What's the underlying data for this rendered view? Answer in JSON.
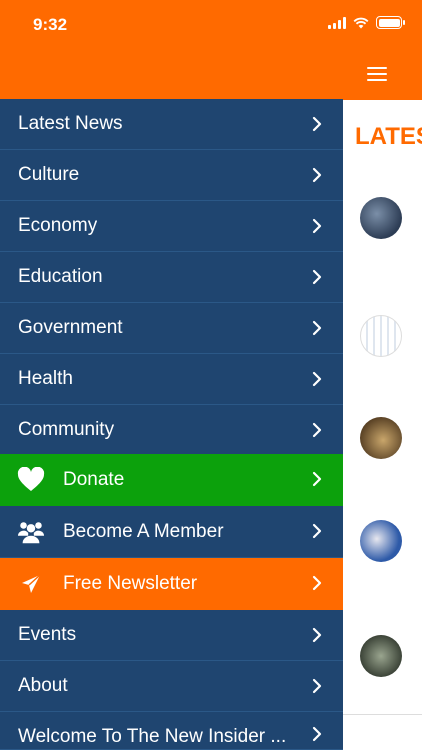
{
  "status": {
    "time": "9:32"
  },
  "app": {
    "section_title": "LATES"
  },
  "menu": [
    {
      "label": "Latest News",
      "style": "blue"
    },
    {
      "label": "Culture",
      "style": "blue"
    },
    {
      "label": "Economy",
      "style": "blue"
    },
    {
      "label": "Education",
      "style": "blue"
    },
    {
      "label": "Government",
      "style": "blue"
    },
    {
      "label": "Health",
      "style": "blue"
    },
    {
      "label": "Community",
      "style": "blue"
    },
    {
      "label": "Donate",
      "style": "green",
      "icon": "heart-icon"
    },
    {
      "label": "Become A Member",
      "style": "blue",
      "icon": "members-icon"
    },
    {
      "label": "Free Newsletter",
      "style": "orange",
      "icon": "paper-plane-icon"
    },
    {
      "label": "Events",
      "style": "blue"
    },
    {
      "label": "About",
      "style": "blue"
    },
    {
      "label": "Welcome To The New Insider ...",
      "style": "blue"
    }
  ],
  "colors": {
    "orange": "#ff6a00",
    "blue": "#1f4570",
    "green": "#0ca10c"
  }
}
